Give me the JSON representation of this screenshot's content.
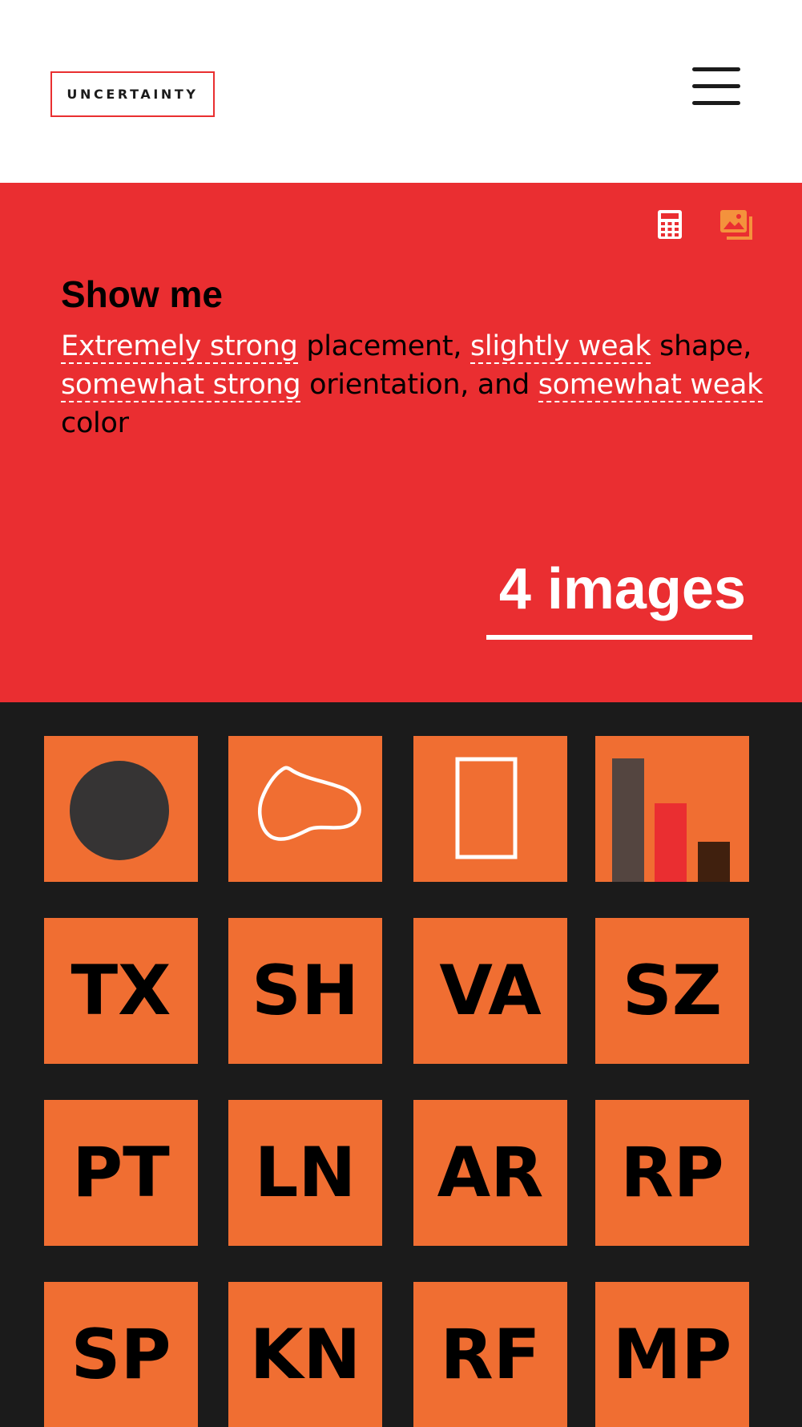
{
  "header": {
    "logo_text": "UNCERTAINTY",
    "menu_icon": "hamburger-menu-icon"
  },
  "hero": {
    "icons": [
      "calculator-icon",
      "image-gallery-icon"
    ],
    "title": "Show me",
    "sentence": {
      "placement_level": "Extremely strong",
      "placement_text": " placement, ",
      "shape_level": "slightly weak",
      "shape_text": " shape, ",
      "orientation_level": "somewhat strong",
      "orientation_text": " orientation, and ",
      "color_level": "somewhat weak",
      "color_text": " color"
    },
    "count_label": "4 images"
  },
  "tiles": {
    "icons": [
      "circle-icon",
      "blob-shape-icon",
      "rectangle-outline-icon",
      "bar-size-icon"
    ],
    "codes": [
      "TX",
      "SH",
      "VA",
      "SZ",
      "PT",
      "LN",
      "AR",
      "RP",
      "SP",
      "KN",
      "RF",
      "MP"
    ]
  },
  "colors": {
    "accent_red": "#ea2e31",
    "tile_orange": "#f06e32",
    "dark_background": "#1b1b1b",
    "white": "#ffffff"
  }
}
